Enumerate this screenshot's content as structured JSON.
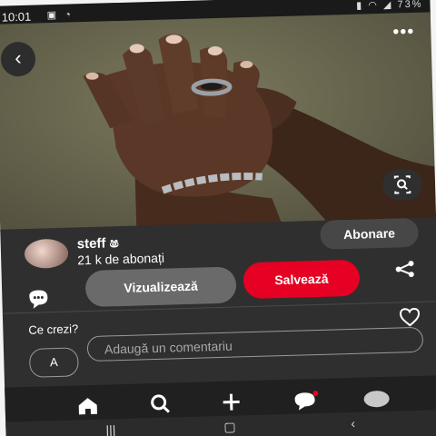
{
  "status_bar": {
    "time": "10:01",
    "battery": "73%"
  },
  "pin": {
    "image_alt": "hands with ring and bracelet"
  },
  "profile": {
    "username": "steff",
    "username_suffix": "ෂ",
    "subscribers": "21 k de abonați",
    "follow_label": "Abonare"
  },
  "actions": {
    "view_label": "Vizualizează",
    "save_label": "Salvează"
  },
  "comments": {
    "prompt": "Ce crezi?",
    "avatar_initial": "A",
    "placeholder": "Adaugă un comentariu"
  },
  "colors": {
    "save": "#e60023",
    "panel": "#2f2f2f",
    "navbar": "#202020"
  },
  "icons": {
    "back": "chevron-left-icon",
    "more": "more-horizontal-icon",
    "lens": "visual-search-icon",
    "chat": "chat-bubble-icon",
    "share": "share-icon",
    "heart": "heart-icon",
    "home": "home-icon",
    "search": "search-icon",
    "create": "plus-icon",
    "messages": "messages-icon",
    "profile": "profile-icon"
  }
}
